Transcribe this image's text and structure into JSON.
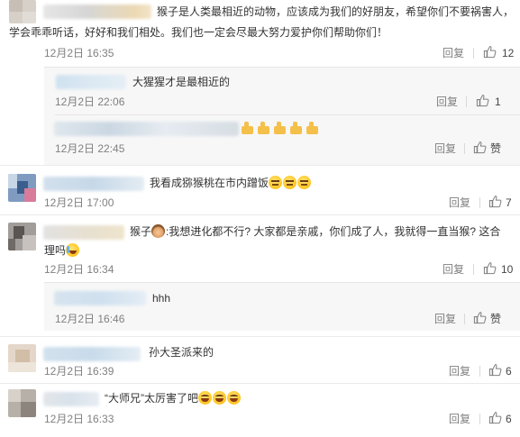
{
  "comments": [
    {
      "text_line1": "猴子是人类最相近的动物，应该成为我们的好朋友，希望你们不要祸害人，",
      "text_line2": "学会乖乖听话，好好和我们相处。我们也一定会尽最大努力爱护你们帮助你们！",
      "time": "12月2日 16:35",
      "reply": "回复",
      "likes": "12"
    },
    {
      "text": "我看成猕猴桃在市内蹭饭",
      "time": "12月2日 17:00",
      "reply": "回复",
      "likes": "7"
    },
    {
      "text_prefix": "猴子",
      "text_line1": ":我想进化都不行? 大家都是亲戚，你们成了人，我就得一直当猴? 这合",
      "text_line2": "理吗",
      "time": "12月2日 16:34",
      "reply": "回复",
      "likes": "10"
    },
    {
      "text": "孙大圣派来的",
      "time": "12月2日 16:39",
      "reply": "回复",
      "likes": "6"
    },
    {
      "text": "“大师兄”太厉害了吧",
      "time": "12月2日 16:33",
      "reply": "回复",
      "likes": "6"
    }
  ],
  "replies": [
    {
      "text": "大猩猩才是最相近的",
      "time": "12月2日 22:06",
      "reply": "回复",
      "likes": "1"
    },
    {
      "text": "",
      "time": "12月2日 22:45",
      "reply": "回复",
      "likes": "赞"
    },
    {
      "text": "hhh",
      "time": "12月2日 16:46",
      "reply": "回复",
      "likes": "赞"
    }
  ],
  "icons": {
    "like": "thumbs-up-icon",
    "emoji_laugh": "laughing-face-icon",
    "emoji_meh": "meh-face-icon",
    "emoji_monkey": "monkey-face-icon",
    "emoji_thumb": "thumbs-up-emoji-icon"
  },
  "colors": {
    "text": "#333333",
    "meta": "#808080",
    "reply_bg": "#f7f7f7",
    "divider": "#ebebeb"
  }
}
